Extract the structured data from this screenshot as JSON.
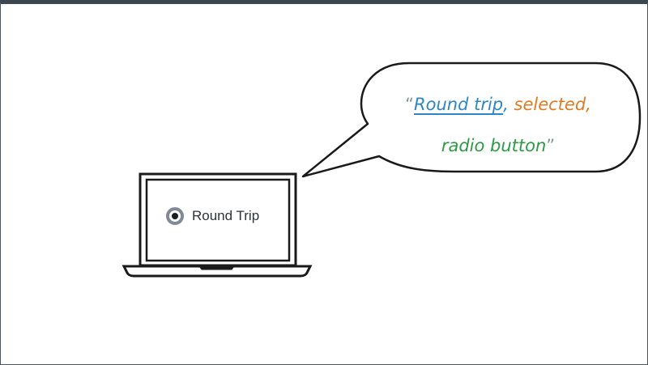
{
  "screen": {
    "radio_label": "Round Trip"
  },
  "speech": {
    "open_quote": "“",
    "name": "Round trip",
    "comma1": ",",
    "state": "selected",
    "comma2": ",",
    "role": "radio button",
    "close_quote": "”"
  },
  "colors": {
    "name": "#2e86c6",
    "state": "#e07b24",
    "role": "#2e9a48"
  }
}
